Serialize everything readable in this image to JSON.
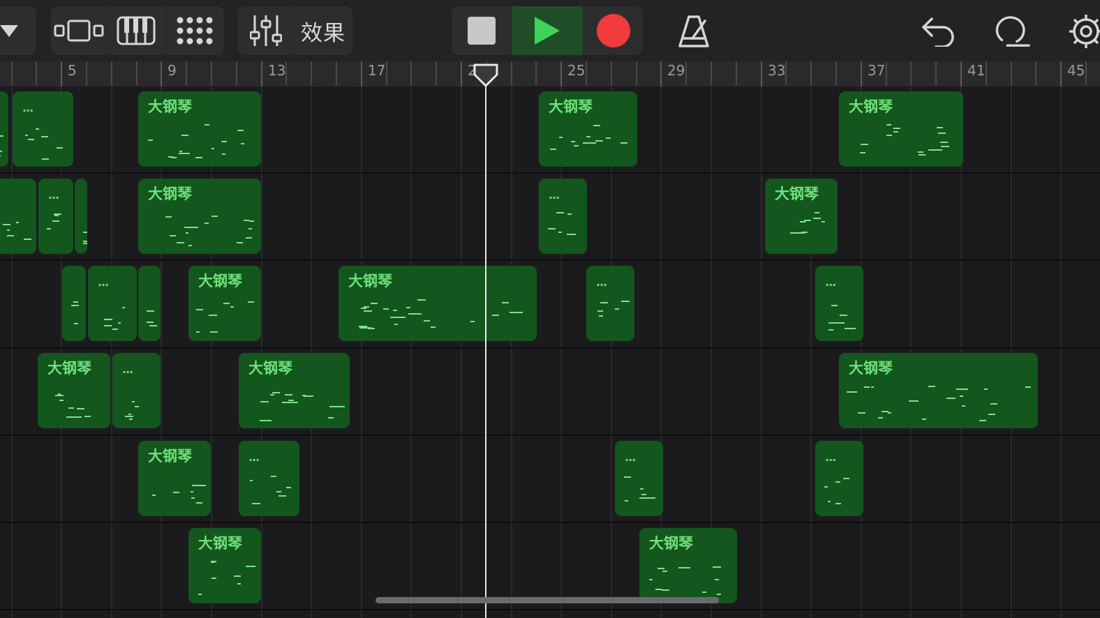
{
  "toolbar": {
    "effects_label": "效果",
    "transport": {
      "stop_color": "#c8c8c8",
      "play_color": "#3ed35a",
      "play_bg": "#1f4d27",
      "record_color": "#f23b3b"
    },
    "icons": [
      "view-menu-icon",
      "tracks-view-icon",
      "keyboard-icon",
      "grid-icon",
      "mixer-icon",
      "metronome-icon",
      "undo-icon",
      "loop-icon",
      "settings-icon"
    ]
  },
  "ruler": {
    "bar_labels": [
      "5",
      "9",
      "13",
      "17",
      "21",
      "25",
      "29",
      "33",
      "37",
      "41",
      "45"
    ]
  },
  "playhead": {
    "bar": 22
  },
  "region_name": "大钢琴",
  "colors": {
    "region_fill": "#13561e",
    "region_text": "#6fe07a",
    "note": "#7ee485"
  },
  "regions": [
    {
      "track": 1,
      "title": "",
      "dots": "..."
    },
    {
      "track": 1,
      "title": "大钢琴",
      "dots": ""
    },
    {
      "track": 1,
      "title": "大钢琴",
      "dots": ""
    },
    {
      "track": 1,
      "title": "大钢琴",
      "dots": ""
    },
    {
      "track": 2,
      "title": "",
      "dots": "..."
    },
    {
      "track": 2,
      "title": "大钢琴",
      "dots": ""
    },
    {
      "track": 2,
      "title": "",
      "dots": "..."
    },
    {
      "track": 2,
      "title": "大钢琴",
      "dots": ""
    },
    {
      "track": 3,
      "title": "",
      "dots": "..."
    },
    {
      "track": 3,
      "title": "大钢琴",
      "dots": ""
    },
    {
      "track": 3,
      "title": "大钢琴",
      "dots": ""
    },
    {
      "track": 3,
      "title": "",
      "dots": "..."
    },
    {
      "track": 3,
      "title": "",
      "dots": "..."
    },
    {
      "track": 4,
      "title": "大钢琴",
      "dots": ""
    },
    {
      "track": 4,
      "title": "",
      "dots": "..."
    },
    {
      "track": 4,
      "title": "大钢琴",
      "dots": ""
    },
    {
      "track": 4,
      "title": "大钢琴",
      "dots": ""
    },
    {
      "track": 5,
      "title": "大钢琴",
      "dots": ""
    },
    {
      "track": 5,
      "title": "",
      "dots": "..."
    },
    {
      "track": 5,
      "title": "",
      "dots": "..."
    },
    {
      "track": 5,
      "title": "",
      "dots": "..."
    },
    {
      "track": 6,
      "title": "大钢琴",
      "dots": ""
    },
    {
      "track": 6,
      "title": "大钢琴",
      "dots": ""
    }
  ]
}
